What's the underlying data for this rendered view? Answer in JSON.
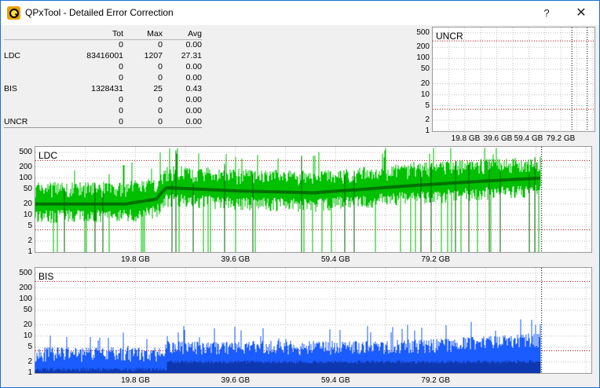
{
  "window": {
    "title": "QPxTool - Detailed Error Correction",
    "help_label": "?",
    "close_label": "✕",
    "icon": "qpxtool-app-icon"
  },
  "stats": {
    "headers": {
      "tot": "Tot",
      "max": "Max",
      "avg": "Avg"
    },
    "rows": [
      {
        "label": "",
        "tot": "0",
        "max": "0",
        "avg": "0.00"
      },
      {
        "label": "LDC",
        "tot": "83416001",
        "max": "1207",
        "avg": "27.31"
      },
      {
        "label": "",
        "tot": "0",
        "max": "0",
        "avg": "0.00"
      },
      {
        "label": "",
        "tot": "0",
        "max": "0",
        "avg": "0.00"
      },
      {
        "label": "BIS",
        "tot": "1328431",
        "max": "25",
        "avg": "0.43"
      },
      {
        "label": "",
        "tot": "0",
        "max": "0",
        "avg": "0.00"
      },
      {
        "label": "",
        "tot": "0",
        "max": "0",
        "avg": "0.00"
      },
      {
        "label": "UNCR",
        "tot": "0",
        "max": "0",
        "avg": "0.00"
      }
    ]
  },
  "chart_data": [
    {
      "type": "area",
      "title": "UNCR",
      "y_scale": "log",
      "y_ticks": [
        "500",
        "200",
        "100",
        "50",
        "20",
        "10",
        "5",
        "2",
        "1"
      ],
      "x_ticks": [
        "19.8 GB",
        "39.6 GB",
        "59.4 GB",
        "79.2 GB"
      ],
      "series": [],
      "colors": {
        "background": "#ffffff",
        "grid": "#c0c0c0",
        "ref_line": "#c00000"
      }
    },
    {
      "type": "area",
      "title": "LDC",
      "y_scale": "log",
      "y_ticks": [
        "500",
        "200",
        "100",
        "50",
        "20",
        "10",
        "5",
        "2",
        "1"
      ],
      "x_ticks": [
        "19.8 GB",
        "39.6 GB",
        "59.4 GB",
        "79.2 GB"
      ],
      "x_end_gb": 100,
      "profile": [
        {
          "x": 0,
          "y": 20
        },
        {
          "x": 18,
          "y": 20
        },
        {
          "x": 24,
          "y": 27
        },
        {
          "x": 26,
          "y": 55
        },
        {
          "x": 40,
          "y": 45
        },
        {
          "x": 55,
          "y": 40
        },
        {
          "x": 65,
          "y": 50
        },
        {
          "x": 80,
          "y": 70
        },
        {
          "x": 100,
          "y": 100
        }
      ],
      "colors": {
        "fill": "#00c000",
        "avg": "#006400",
        "background": "#ffffff",
        "grid": "#c0c0c0",
        "ref_line": "#c00000"
      }
    },
    {
      "type": "area",
      "title": "BIS",
      "y_scale": "log",
      "y_ticks": [
        "500",
        "200",
        "100",
        "50",
        "20",
        "10",
        "5",
        "2",
        "1"
      ],
      "x_ticks": [
        "19.8 GB",
        "39.6 GB",
        "59.4 GB",
        "79.2 GB"
      ],
      "x_end_gb": 100,
      "profile": [
        {
          "x": 0,
          "y": 2
        },
        {
          "x": 25,
          "y": 2
        },
        {
          "x": 26,
          "y": 3
        },
        {
          "x": 65,
          "y": 3
        },
        {
          "x": 80,
          "y": 3.5
        },
        {
          "x": 100,
          "y": 5
        }
      ],
      "colors": {
        "fill": "#1a5cff",
        "dark": "#0a2a90",
        "background": "#ffffff",
        "grid": "#c0c0c0",
        "ref_line": "#c00000"
      }
    }
  ]
}
